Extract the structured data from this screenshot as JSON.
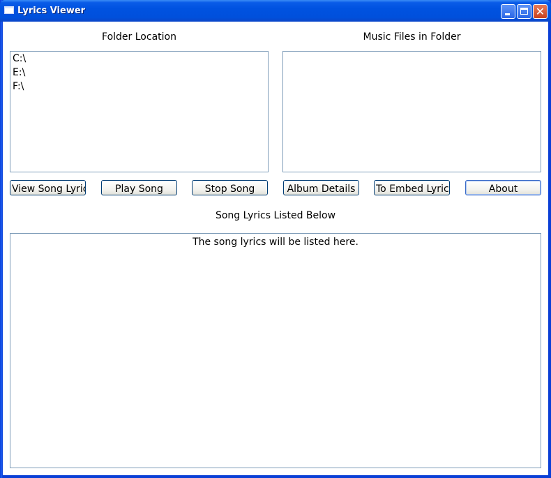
{
  "window": {
    "title": "Lyrics Viewer",
    "controls": {
      "minimize": "minimize-icon",
      "maximize": "maximize-icon",
      "close": "close-icon",
      "close_glyph": "✕"
    }
  },
  "folder_panel": {
    "label": "Folder Location",
    "items": [
      "C:\\",
      "E:\\",
      "F:\\"
    ]
  },
  "music_panel": {
    "label": "Music Files in Folder",
    "items": []
  },
  "buttons": {
    "view_lyrics": "View Song Lyric",
    "play_song": "Play Song",
    "stop_song": "Stop Song",
    "album_details": "Album Details",
    "embed_lyrics": "To Embed Lyric",
    "about": "About"
  },
  "lyrics": {
    "label": "Song Lyrics Listed Below",
    "text": "The song lyrics will be listed here."
  }
}
